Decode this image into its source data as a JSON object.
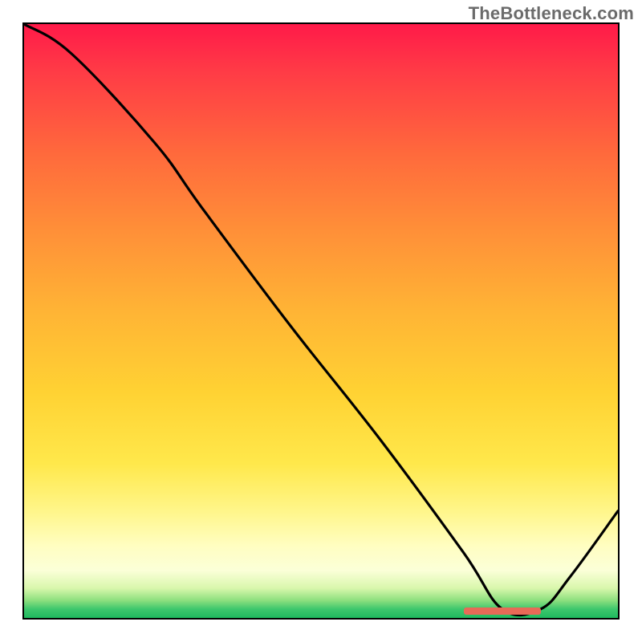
{
  "watermark": "TheBottleneck.com",
  "chart_data": {
    "type": "line",
    "title": "",
    "xlabel": "",
    "ylabel": "",
    "xlim": [
      0,
      100
    ],
    "ylim": [
      0,
      100
    ],
    "series": [
      {
        "name": "bottleneck-curve",
        "x": [
          0,
          8,
          22,
          30,
          45,
          60,
          74,
          80.5,
          87,
          92,
          100
        ],
        "values": [
          100,
          95,
          80,
          69,
          49,
          30,
          11,
          1.5,
          1.5,
          7,
          18
        ]
      }
    ],
    "annotations": [
      {
        "name": "optimal-range-marker",
        "type": "hspan",
        "x_start": 74,
        "x_end": 87,
        "y": 1.2,
        "color": "#e86a57"
      }
    ],
    "background_gradient": {
      "top": "#ff1a49",
      "mid": "#ffd233",
      "bottom": "#1fb95f"
    },
    "grid": false,
    "legend": false
  }
}
